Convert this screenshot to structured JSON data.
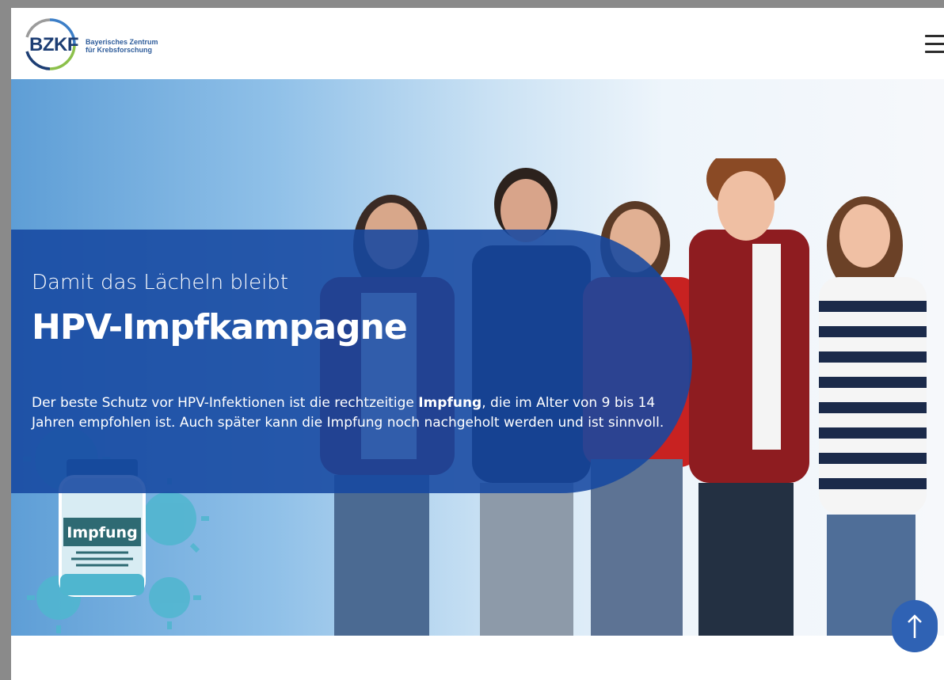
{
  "header": {
    "logo": {
      "abbr": "BZKF",
      "subtitle_line1": "Bayerisches Zentrum",
      "subtitle_line2": "für Krebsforschung"
    },
    "menu_icon": "hamburger-menu-icon"
  },
  "hero": {
    "tagline": "Damit das Lächeln bleibt",
    "headline": "HPV-Impfkampagne",
    "description_part1": "Der beste Schutz vor HPV-Infektionen ist die rechtzeitige ",
    "description_bold": "Impfung",
    "description_part2": ", die im Alter von 9 bis 14 Jahren empfohlen ist. Auch später kann die Impfung noch nachgeholt werden und ist sinnvoll.",
    "vial_label": "Impfung"
  },
  "scroll_top_icon": "arrow-up-icon",
  "colors": {
    "brand_blue": "#1d3e74",
    "overlay_blue": "#1648a0",
    "scroll_button": "#2f62b4"
  }
}
